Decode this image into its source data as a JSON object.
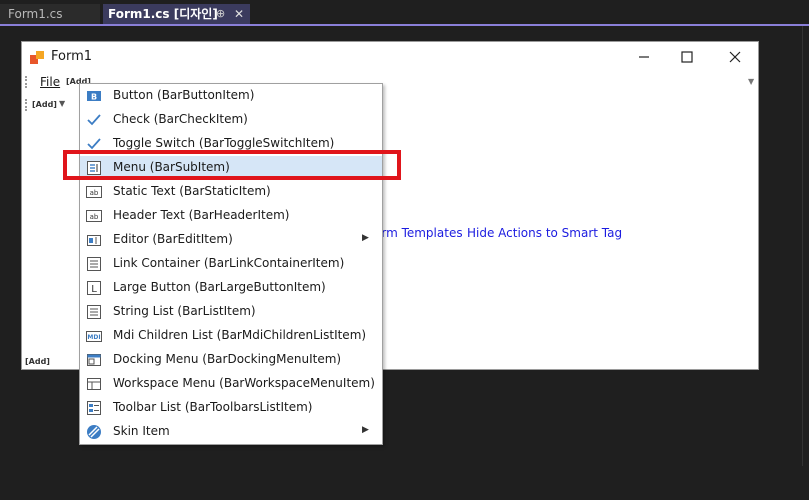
{
  "tabs": [
    {
      "label": "Form1.cs"
    },
    {
      "label": "Form1.cs [디자인]",
      "pin": "⊕",
      "close": "✕"
    }
  ],
  "form": {
    "title": "Form1",
    "menu_file": "File",
    "menu_add": "[Add]",
    "toolbar_add": "[Add]",
    "status_add": "[Add]",
    "links": [
      "orm Templates",
      "Hide Actions to Smart Tag"
    ]
  },
  "popup_menu": {
    "items": [
      {
        "label": "Button (BarButtonItem)",
        "icon": "button-icon"
      },
      {
        "label": "Check (BarCheckItem)",
        "icon": "check-icon"
      },
      {
        "label": "Toggle Switch (BarToggleSwitchItem)",
        "icon": "check-icon"
      },
      {
        "label": "Menu (BarSubItem)",
        "icon": "menu-icon",
        "highlighted": true
      },
      {
        "label": "Static Text (BarStaticItem)",
        "icon": "ab-icon"
      },
      {
        "label": "Header Text (BarHeaderItem)",
        "icon": "ab-icon"
      },
      {
        "label": "Editor (BarEditItem)",
        "icon": "editor-icon",
        "submenu": true
      },
      {
        "label": "Link Container (BarLinkContainerItem)",
        "icon": "list-icon"
      },
      {
        "label": "Large Button (BarLargeButtonItem)",
        "icon": "large-button-icon"
      },
      {
        "label": "String List (BarListItem)",
        "icon": "list-icon"
      },
      {
        "label": "Mdi Children List (BarMdiChildrenListItem)",
        "icon": "mdi-icon"
      },
      {
        "label": "Docking Menu (BarDockingMenuItem)",
        "icon": "window-icon"
      },
      {
        "label": "Workspace Menu (BarWorkspaceMenuItem)",
        "icon": "window-icon"
      },
      {
        "label": "Toolbar List (BarToolbarsListItem)",
        "icon": "toolbar-list-icon"
      },
      {
        "label": "Skin Item",
        "icon": "skin-icon",
        "submenu": true
      }
    ]
  },
  "colors": {
    "accent": "#8a7fd8",
    "highlight_frame": "#e0151b",
    "highlight_row": "#d6e6f7",
    "link": "#1c1ce0"
  }
}
